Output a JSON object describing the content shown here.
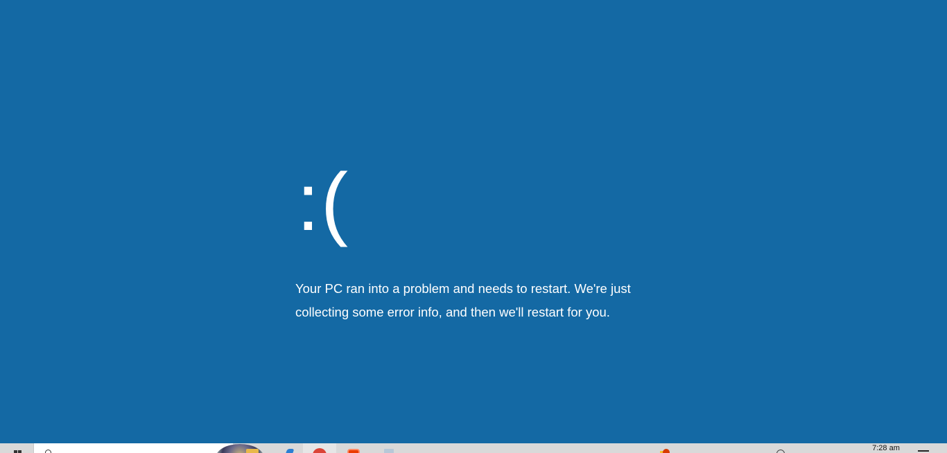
{
  "screen": {
    "background_color": "#1469a4",
    "sad_face": ":(",
    "message": "Your PC ran into a problem and needs to restart. We're just collecting some error info, and then we'll restart for you."
  },
  "taskbar": {
    "background_color": "#d9d9d9",
    "start_icon": "windows-logo-icon",
    "search_icon": "search-icon",
    "cortana_icon": "cortana-icon",
    "pinned_apps": [
      {
        "icon": "file-explorer-icon"
      },
      {
        "icon": "edge-icon"
      },
      {
        "icon": "chrome-icon"
      },
      {
        "icon": "office-icon"
      },
      {
        "icon": "notepad-icon"
      }
    ],
    "tray": {
      "warning_icon": "security-warning-icon",
      "network_icon": "network-icon",
      "clock": "7:28 am",
      "action_center_icon": "action-center-icon"
    }
  }
}
